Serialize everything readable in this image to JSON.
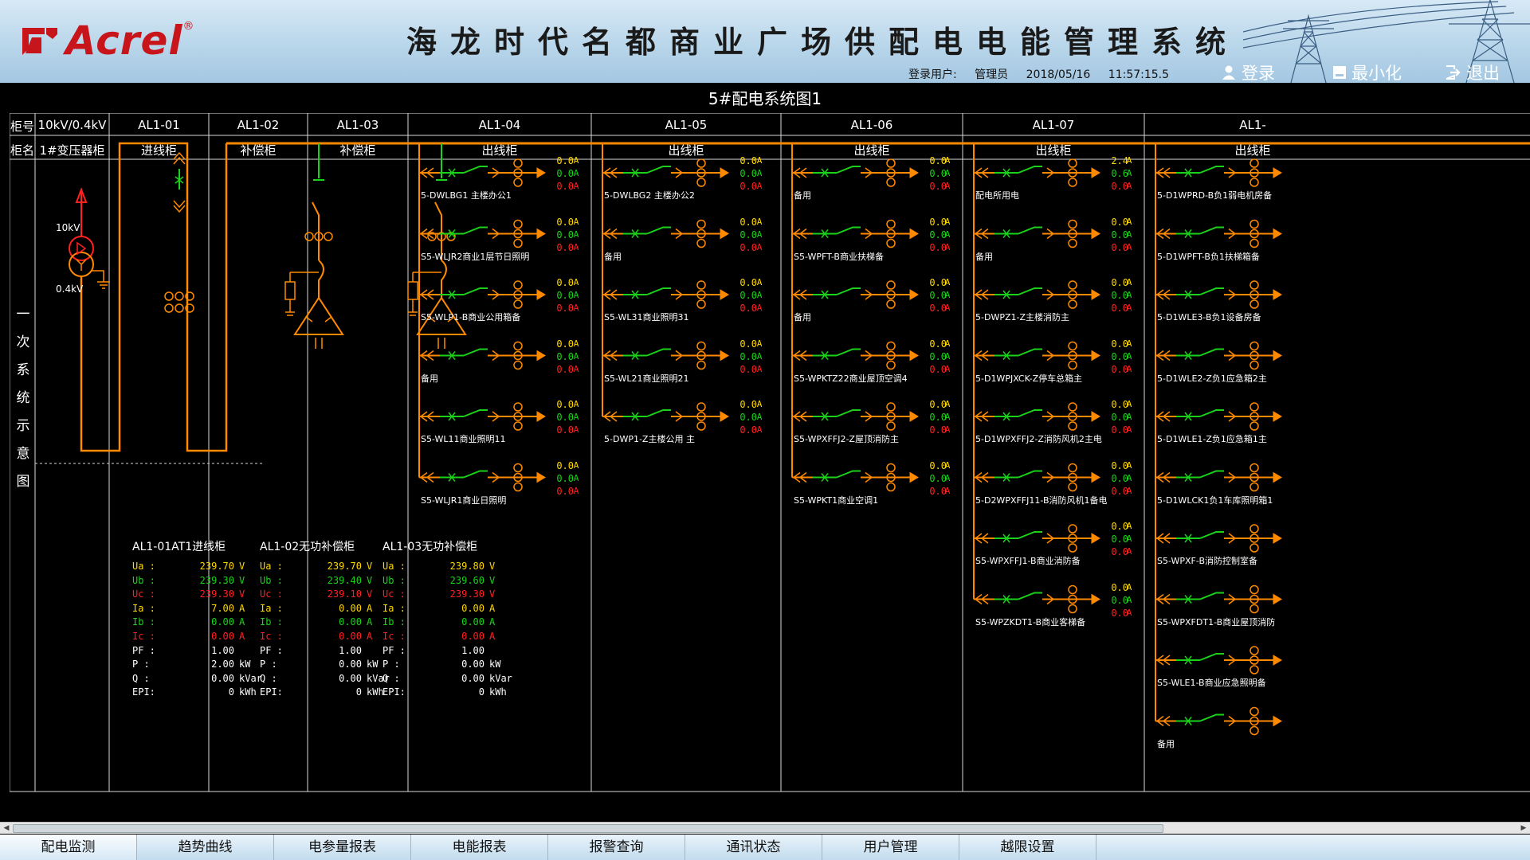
{
  "header": {
    "logo_text": "Acrel",
    "logo_mark": "®",
    "title": "海龙时代名都商业广场供配电电能管理系统",
    "login_user_label": "登录用户:",
    "user_name": "管理员",
    "date": "2018/05/16",
    "time": "11:57:15.5",
    "login_button": "登录",
    "minimize_button": "最小化",
    "exit_button": "退出"
  },
  "page_title": "5#配电系统图1",
  "row_labels": {
    "cabinet_no": "柜号",
    "cabinet_name": "柜名"
  },
  "columns": [
    {
      "no": "10kV/0.4kV",
      "name": "1#变压器柜"
    },
    {
      "no": "AL1-01",
      "name": "进线柜"
    },
    {
      "no": "AL1-02",
      "name": "补偿柜"
    },
    {
      "no": "AL1-03",
      "name": "补偿柜"
    },
    {
      "no": "AL1-04",
      "name": "出线柜"
    },
    {
      "no": "AL1-05",
      "name": "出线柜"
    },
    {
      "no": "AL1-06",
      "name": "出线柜"
    },
    {
      "no": "AL1-07",
      "name": "出线柜"
    },
    {
      "no": "AL1-",
      "name": "出线柜"
    }
  ],
  "side_label": [
    "一",
    "次",
    "系",
    "统",
    "示",
    "意",
    "图"
  ],
  "transformer": {
    "hv": "10kV",
    "lv": "0.4kV"
  },
  "meters": [
    {
      "title": "AL1-01AT1进线柜",
      "rows": [
        {
          "label": "Ua :",
          "value": "239.70",
          "unit": "V",
          "color": "#ffd800"
        },
        {
          "label": "Ub :",
          "value": "239.30",
          "unit": "V",
          "color": "#19d219"
        },
        {
          "label": "Uc :",
          "value": "239.30",
          "unit": "V",
          "color": "#ff2020"
        },
        {
          "label": "Ia :",
          "value": "7.00",
          "unit": "A",
          "color": "#ffd800"
        },
        {
          "label": "Ib :",
          "value": "0.00",
          "unit": "A",
          "color": "#19d219"
        },
        {
          "label": "Ic :",
          "value": "0.00",
          "unit": "A",
          "color": "#ff2020"
        },
        {
          "label": "PF :",
          "value": "1.00",
          "unit": "",
          "color": "#ffffff"
        },
        {
          "label": "P  :",
          "value": "2.00",
          "unit": "kW",
          "color": "#ffffff"
        },
        {
          "label": "Q  :",
          "value": "0.00",
          "unit": "kVar",
          "color": "#ffffff"
        },
        {
          "label": "EPI:",
          "value": "0",
          "unit": "kWh",
          "color": "#ffffff"
        }
      ]
    },
    {
      "title": "AL1-02无功补偿柜",
      "rows": [
        {
          "label": "Ua :",
          "value": "239.70",
          "unit": "V",
          "color": "#ffd800"
        },
        {
          "label": "Ub :",
          "value": "239.40",
          "unit": "V",
          "color": "#19d219"
        },
        {
          "label": "Uc :",
          "value": "239.10",
          "unit": "V",
          "color": "#ff2020"
        },
        {
          "label": "Ia :",
          "value": "0.00",
          "unit": "A",
          "color": "#ffd800"
        },
        {
          "label": "Ib :",
          "value": "0.00",
          "unit": "A",
          "color": "#19d219"
        },
        {
          "label": "Ic :",
          "value": "0.00",
          "unit": "A",
          "color": "#ff2020"
        },
        {
          "label": "PF :",
          "value": "1.00",
          "unit": "",
          "color": "#ffffff"
        },
        {
          "label": "P  :",
          "value": "0.00",
          "unit": "kW",
          "color": "#ffffff"
        },
        {
          "label": "Q  :",
          "value": "0.00",
          "unit": "kVar",
          "color": "#ffffff"
        },
        {
          "label": "EPI:",
          "value": "0",
          "unit": "kWh",
          "color": "#ffffff"
        }
      ]
    },
    {
      "title": "AL1-03无功补偿柜",
      "rows": [
        {
          "label": "Ua :",
          "value": "239.80",
          "unit": "V",
          "color": "#ffd800"
        },
        {
          "label": "Ub :",
          "value": "239.60",
          "unit": "V",
          "color": "#19d219"
        },
        {
          "label": "Uc :",
          "value": "239.30",
          "unit": "V",
          "color": "#ff2020"
        },
        {
          "label": "Ia :",
          "value": "0.00",
          "unit": "A",
          "color": "#ffd800"
        },
        {
          "label": "Ib :",
          "value": "0.00",
          "unit": "A",
          "color": "#19d219"
        },
        {
          "label": "Ic :",
          "value": "0.00",
          "unit": "A",
          "color": "#ff2020"
        },
        {
          "label": "PF :",
          "value": "1.00",
          "unit": "",
          "color": "#ffffff"
        },
        {
          "label": "P  :",
          "value": "0.00",
          "unit": "kW",
          "color": "#ffffff"
        },
        {
          "label": "Q  :",
          "value": "0.00",
          "unit": "kVar",
          "color": "#ffffff"
        },
        {
          "label": "EPI:",
          "value": "0",
          "unit": "kWh",
          "color": "#ffffff"
        }
      ]
    }
  ],
  "current_unit": "A",
  "phase_colors": [
    "#ffd800",
    "#19d219",
    "#ff2020"
  ],
  "feeder_groups": [
    {
      "cabinet": "AL1-04",
      "feeders": [
        {
          "name": "5-DWLBG1 主楼办公1",
          "ia": "0.0",
          "ib": "0.0",
          "ic": "0.0"
        },
        {
          "name": "S5-WLJR2商业1层节日照明",
          "ia": "0.0",
          "ib": "0.0",
          "ic": "0.0"
        },
        {
          "name": "S5-WLP1-B商业公用箱备",
          "ia": "0.0",
          "ib": "0.0",
          "ic": "0.0"
        },
        {
          "name": "备用",
          "ia": "0.0",
          "ib": "0.0",
          "ic": "0.0"
        },
        {
          "name": "S5-WL11商业照明11",
          "ia": "0.0",
          "ib": "0.0",
          "ic": "0.0"
        },
        {
          "name": "S5-WLJR1商业日照明",
          "ia": "0.0",
          "ib": "0.0",
          "ic": "0.0"
        }
      ]
    },
    {
      "cabinet": "AL1-05",
      "feeders": [
        {
          "name": "5-DWLBG2 主楼办公2",
          "ia": "0.0",
          "ib": "0.0",
          "ic": "0.0"
        },
        {
          "name": "备用",
          "ia": "0.0",
          "ib": "0.0",
          "ic": "0.0"
        },
        {
          "name": "S5-WL31商业照明31",
          "ia": "0.0",
          "ib": "0.0",
          "ic": "0.0"
        },
        {
          "name": "S5-WL21商业照明21",
          "ia": "0.0",
          "ib": "0.0",
          "ic": "0.0"
        },
        {
          "name": "5-DWP1-Z主楼公用 主",
          "ia": "0.0",
          "ib": "0.0",
          "ic": "0.0"
        }
      ]
    },
    {
      "cabinet": "AL1-06",
      "feeders": [
        {
          "name": "备用",
          "ia": "0.0",
          "ib": "0.0",
          "ic": "0.0"
        },
        {
          "name": "S5-WPFT-B商业扶梯备",
          "ia": "0.0",
          "ib": "0.0",
          "ic": "0.0"
        },
        {
          "name": "备用",
          "ia": "0.0",
          "ib": "0.0",
          "ic": "0.0"
        },
        {
          "name": "S5-WPKTZ22商业屋顶空调4",
          "ia": "0.0",
          "ib": "0.0",
          "ic": "0.0"
        },
        {
          "name": "S5-WPXFFJ2-Z屋顶消防主",
          "ia": "0.0",
          "ib": "0.0",
          "ic": "0.0"
        },
        {
          "name": "S5-WPKT1商业空调1",
          "ia": "0.0",
          "ib": "0.0",
          "ic": "0.0"
        }
      ]
    },
    {
      "cabinet": "AL1-07",
      "feeders": [
        {
          "name": "配电所用电",
          "ia": "2.4",
          "ib": "0.6",
          "ic": "0.0"
        },
        {
          "name": "备用",
          "ia": "0.0",
          "ib": "0.0",
          "ic": "0.0"
        },
        {
          "name": "5-DWPZ1-Z主楼消防主",
          "ia": "0.0",
          "ib": "0.0",
          "ic": "0.0"
        },
        {
          "name": "5-D1WPJXCK-Z停车总箱主",
          "ia": "0.0",
          "ib": "0.0",
          "ic": "0.0"
        },
        {
          "name": "5-D1WPXFFJ2-Z消防风机2主电",
          "ia": "0.0",
          "ib": "0.0",
          "ic": "0.0"
        },
        {
          "name": "5-D2WPXFFJ11-B消防风机1备电",
          "ia": "0.0",
          "ib": "0.0",
          "ic": "0.0"
        },
        {
          "name": "S5-WPXFFJ1-B商业消防备",
          "ia": "0.0",
          "ib": "0.0",
          "ic": "0.0"
        },
        {
          "name": "S5-WPZKDT1-B商业客梯备",
          "ia": "0.0",
          "ib": "0.0",
          "ic": "0.0"
        }
      ]
    },
    {
      "cabinet": "AL1-",
      "feeders": [
        {
          "name": "5-D1WPRD-B负1弱电机房备",
          "ia": "",
          "ib": "",
          "ic": ""
        },
        {
          "name": "5-D1WPFT-B负1扶梯箱备",
          "ia": "",
          "ib": "",
          "ic": ""
        },
        {
          "name": "5-D1WLE3-B负1设备房备",
          "ia": "",
          "ib": "",
          "ic": ""
        },
        {
          "name": "5-D1WLE2-Z负1应急箱2主",
          "ia": "",
          "ib": "",
          "ic": ""
        },
        {
          "name": "5-D1WLE1-Z负1应急箱1主",
          "ia": "",
          "ib": "",
          "ic": ""
        },
        {
          "name": "5-D1WLCK1负1车库照明箱1",
          "ia": "",
          "ib": "",
          "ic": ""
        },
        {
          "name": "S5-WPXF-B消防控制室备",
          "ia": "",
          "ib": "",
          "ic": ""
        },
        {
          "name": "S5-WPXFDT1-B商业屋顶消防",
          "ia": "",
          "ib": "",
          "ic": ""
        },
        {
          "name": "S5-WLE1-B商业应急照明备",
          "ia": "",
          "ib": "",
          "ic": ""
        },
        {
          "name": "备用",
          "ia": "",
          "ib": "",
          "ic": ""
        }
      ]
    }
  ],
  "tabs": [
    "配电监测",
    "趋势曲线",
    "电参量报表",
    "电能报表",
    "报警查询",
    "通讯状态",
    "用户管理",
    "越限设置"
  ],
  "colors": {
    "bus": "#ff8a00",
    "breaker_closed": "#19d219",
    "header_bg": "#b9d6ea",
    "grid_line": "#d8d8d8"
  }
}
